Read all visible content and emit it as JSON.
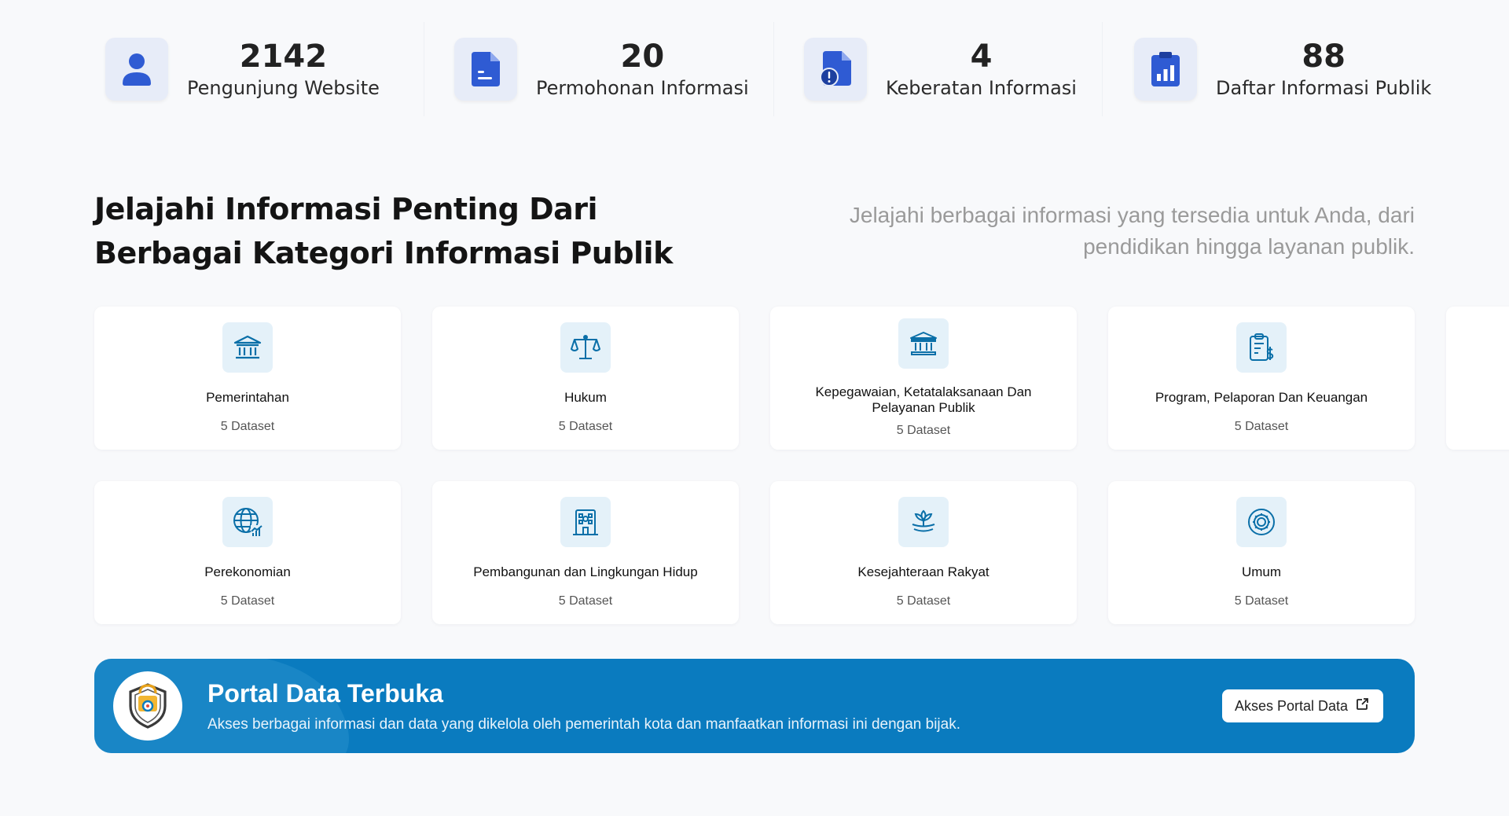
{
  "stats": [
    {
      "value": "2142",
      "label": "Pengunjung Website",
      "icon": "user-icon"
    },
    {
      "value": "20",
      "label": "Permohonan Informasi",
      "icon": "document-icon"
    },
    {
      "value": "4",
      "label": "Keberatan Informasi",
      "icon": "document-alert-icon"
    },
    {
      "value": "88",
      "label": "Daftar Informasi Publik",
      "icon": "clipboard-chart-icon"
    }
  ],
  "section": {
    "title": "Jelajahi Informasi Penting Dari Berbagai Kategori Informasi Publik",
    "subtitle": "Jelajahi berbagai informasi yang tersedia untuk Anda, dari pendidikan hingga layanan publik."
  },
  "categories": [
    {
      "title": "Pemerintahan",
      "count": "5 Dataset",
      "icon": "government-building-icon"
    },
    {
      "title": "Hukum",
      "count": "5 Dataset",
      "icon": "scales-icon"
    },
    {
      "title": "Kepegawaian, Ketatalaksanaan Dan Pelayanan Publik",
      "count": "5 Dataset",
      "icon": "institution-icon"
    },
    {
      "title": "Program, Pelaporan Dan Keuangan",
      "count": "5 Dataset",
      "icon": "finance-report-icon"
    },
    {
      "title": "Perekonomian",
      "count": "5 Dataset",
      "icon": "globe-chart-icon"
    },
    {
      "title": "Pembangunan dan Lingkungan Hidup",
      "count": "5 Dataset",
      "icon": "building-plan-icon"
    },
    {
      "title": "Kesejahteraan Rakyat",
      "count": "5 Dataset",
      "icon": "hand-lotus-icon"
    },
    {
      "title": "Umum",
      "count": "5 Dataset",
      "icon": "gear-circle-icon"
    }
  ],
  "banner": {
    "title": "Portal Data Terbuka",
    "description": "Akses berbagai informasi dan data yang dikelola oleh pemerintah kota dan manfaatkan informasi ini dengan bijak.",
    "button_label": "Akses Portal Data"
  },
  "colors": {
    "accent": "#0a7bbf",
    "stat_icon": "#2f5bd3",
    "category_icon": "#0a6fa8"
  }
}
